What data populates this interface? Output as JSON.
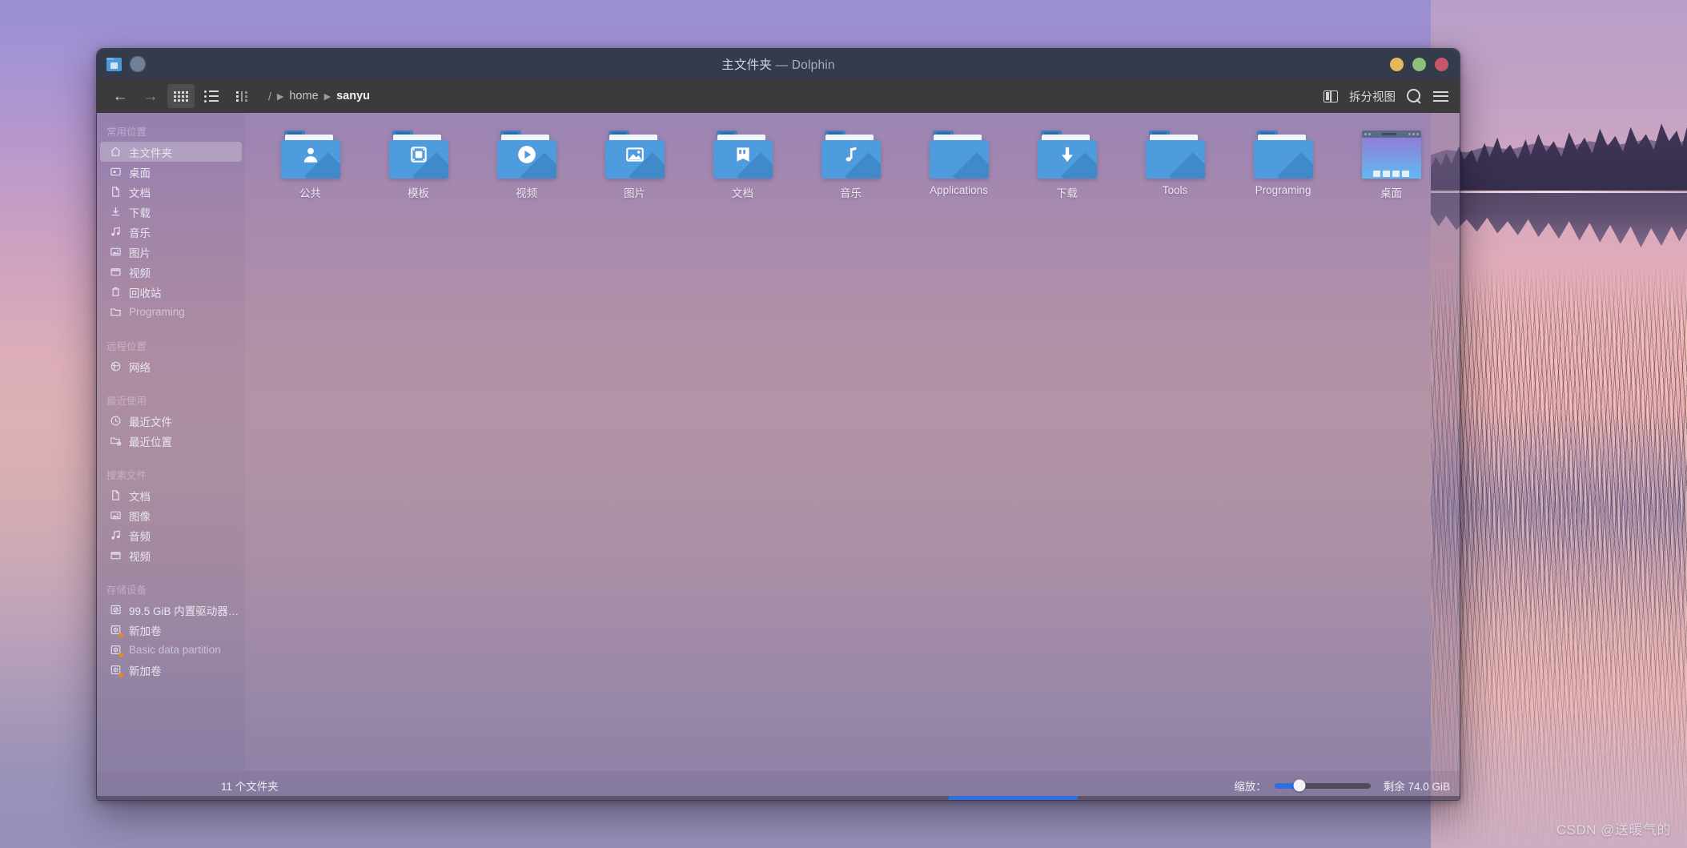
{
  "window": {
    "title_doc": "主文件夹",
    "title_sep": " — ",
    "title_app": "Dolphin",
    "app_icon": "folder-icon",
    "menu_circle": "window-menu-button",
    "minimize": "minimize-button",
    "maximize": "maximize-button",
    "close": "close-button"
  },
  "toolbar": {
    "back": "←",
    "forward": "→",
    "view_icons": "icons-view",
    "view_compact": "compact-view",
    "view_details": "details-view",
    "split_label": "拆分视图",
    "search": "search-icon",
    "menu": "hamburger-icon",
    "breadcrumb": {
      "root": "/",
      "items": [
        {
          "label": "home",
          "current": false
        },
        {
          "label": "sanyu",
          "current": true
        }
      ],
      "separator": "▶"
    }
  },
  "sidebar": {
    "sections": [
      {
        "title": "常用位置",
        "items": [
          {
            "label": "主文件夹",
            "icon": "home-icon",
            "selected": true,
            "dim": false
          },
          {
            "label": "桌面",
            "icon": "desktop-icon",
            "selected": false,
            "dim": false
          },
          {
            "label": "文档",
            "icon": "document-icon",
            "selected": false,
            "dim": false
          },
          {
            "label": "下载",
            "icon": "download-icon",
            "selected": false,
            "dim": false
          },
          {
            "label": "音乐",
            "icon": "music-icon",
            "selected": false,
            "dim": false
          },
          {
            "label": "图片",
            "icon": "image-icon",
            "selected": false,
            "dim": false
          },
          {
            "label": "视频",
            "icon": "video-icon",
            "selected": false,
            "dim": false
          },
          {
            "label": "回收站",
            "icon": "trash-icon",
            "selected": false,
            "dim": false
          },
          {
            "label": "Programing",
            "icon": "folder-icon",
            "selected": false,
            "dim": true
          }
        ]
      },
      {
        "title": "远程位置",
        "items": [
          {
            "label": "网络",
            "icon": "network-icon",
            "selected": false,
            "dim": false
          }
        ]
      },
      {
        "title": "最近使用",
        "items": [
          {
            "label": "最近文件",
            "icon": "clock-icon",
            "selected": false,
            "dim": false
          },
          {
            "label": "最近位置",
            "icon": "folder-clock-icon",
            "selected": false,
            "dim": false
          }
        ]
      },
      {
        "title": "搜索文件",
        "items": [
          {
            "label": "文档",
            "icon": "document-icon",
            "selected": false,
            "dim": false
          },
          {
            "label": "图像",
            "icon": "image-icon",
            "selected": false,
            "dim": false
          },
          {
            "label": "音频",
            "icon": "music-icon",
            "selected": false,
            "dim": false
          },
          {
            "label": "视频",
            "icon": "video-icon",
            "selected": false,
            "dim": false
          }
        ]
      },
      {
        "title": "存储设备",
        "items": [
          {
            "label": "99.5 GiB 内置驱动器 (s...",
            "icon": "harddisk-icon",
            "selected": false,
            "dim": false,
            "meter": true
          },
          {
            "label": "新加卷",
            "icon": "partition-icon",
            "selected": false,
            "dim": false,
            "warn": true
          },
          {
            "label": "Basic data partition",
            "icon": "partition-icon",
            "selected": false,
            "dim": true,
            "warn": true
          },
          {
            "label": "新加卷",
            "icon": "partition-icon",
            "selected": false,
            "dim": false,
            "warn": true
          }
        ]
      }
    ]
  },
  "files": [
    {
      "name": "公共",
      "icon": "folder-public",
      "emblem": "person"
    },
    {
      "name": "模板",
      "icon": "folder-templates",
      "emblem": "template"
    },
    {
      "name": "视频",
      "icon": "folder-videos",
      "emblem": "play"
    },
    {
      "name": "图片",
      "icon": "folder-pictures",
      "emblem": "picture"
    },
    {
      "name": "文档",
      "icon": "folder-documents",
      "emblem": "book"
    },
    {
      "name": "音乐",
      "icon": "folder-music",
      "emblem": "note"
    },
    {
      "name": "Applications",
      "icon": "folder-plain",
      "emblem": "none"
    },
    {
      "name": "下载",
      "icon": "folder-downloads",
      "emblem": "arrow-down"
    },
    {
      "name": "Tools",
      "icon": "folder-plain",
      "emblem": "none"
    },
    {
      "name": "Programing",
      "icon": "folder-plain",
      "emblem": "none"
    },
    {
      "name": "桌面",
      "icon": "desktop-thumbnail",
      "emblem": "none"
    }
  ],
  "statusbar": {
    "count": "11 个文件夹",
    "zoom_label": "缩放：",
    "zoom_value": 26,
    "free_space": "剩余 74.0 GiB",
    "free_used_pct": 26
  },
  "watermark": "CSDN @送暖气的",
  "colors": {
    "titlebar": "#343b4a",
    "toolbar": "#3b3b3b",
    "accent": "#2f6fe0",
    "folder": "#4e9bdd",
    "min": "#e5b95b",
    "max": "#8ec07c",
    "close": "#c6576b"
  }
}
